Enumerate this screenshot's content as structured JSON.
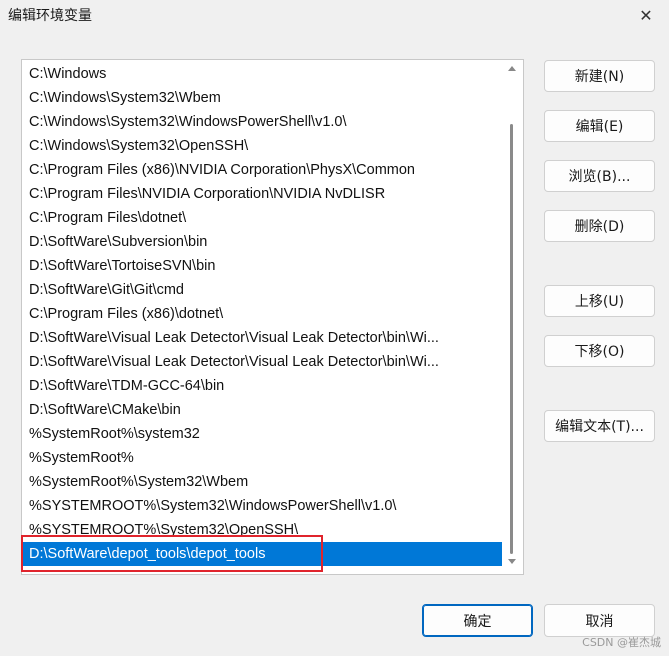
{
  "window": {
    "title": "编辑环境变量",
    "close_glyph": "✕"
  },
  "path_list": {
    "items": [
      "C:\\Windows",
      "C:\\Windows\\System32\\Wbem",
      "C:\\Windows\\System32\\WindowsPowerShell\\v1.0\\",
      "C:\\Windows\\System32\\OpenSSH\\",
      "C:\\Program Files (x86)\\NVIDIA Corporation\\PhysX\\Common",
      "C:\\Program Files\\NVIDIA Corporation\\NVIDIA NvDLISR",
      "C:\\Program Files\\dotnet\\",
      "D:\\SoftWare\\Subversion\\bin",
      "D:\\SoftWare\\TortoiseSVN\\bin",
      "D:\\SoftWare\\Git\\Git\\cmd",
      "C:\\Program Files (x86)\\dotnet\\",
      "D:\\SoftWare\\Visual Leak Detector\\Visual Leak Detector\\bin\\Wi...",
      "D:\\SoftWare\\Visual Leak Detector\\Visual Leak Detector\\bin\\Wi...",
      "D:\\SoftWare\\TDM-GCC-64\\bin",
      "D:\\SoftWare\\CMake\\bin",
      "%SystemRoot%\\system32",
      "%SystemRoot%",
      "%SystemRoot%\\System32\\Wbem",
      "%SYSTEMROOT%\\System32\\WindowsPowerShell\\v1.0\\",
      "%SYSTEMROOT%\\System32\\OpenSSH\\",
      "D:\\SoftWare\\depot_tools\\depot_tools"
    ],
    "selected_index": 20,
    "selected_color": "#0078d7",
    "highlight_color": "#e0242c"
  },
  "buttons": {
    "new": "新建(N)",
    "edit": "编辑(E)",
    "browse": "浏览(B)...",
    "delete": "删除(D)",
    "move_up": "上移(U)",
    "move_down": "下移(O)",
    "edit_text": "编辑文本(T)...",
    "ok": "确定",
    "cancel": "取消"
  },
  "watermark": "CSDN @崔杰城"
}
